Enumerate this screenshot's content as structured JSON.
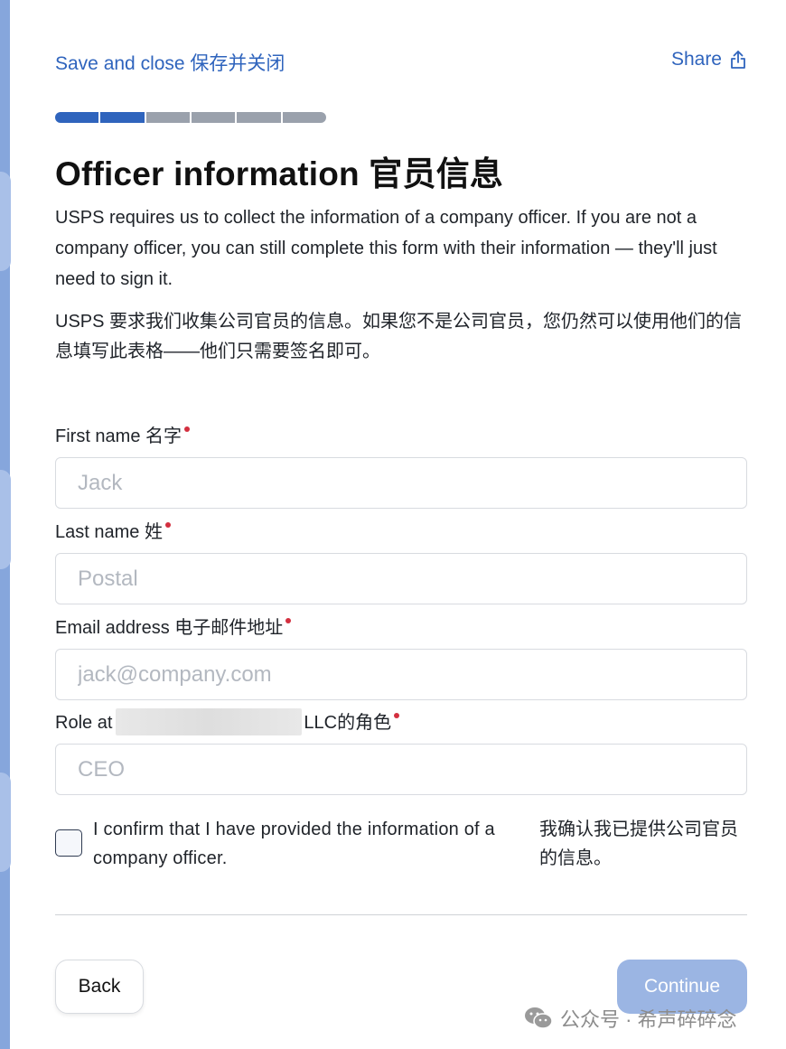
{
  "header": {
    "save_close_label": "Save and close 保存并关闭",
    "share_label": "Share"
  },
  "progress": {
    "completed_steps": 2,
    "total_steps": 6
  },
  "page": {
    "title": "Officer information 官员信息",
    "description_en": "USPS requires us to collect the information of a company officer. If you are not a company officer, you can still complete this form with their information — they'll just need to sign it.",
    "description_zh": "USPS 要求我们收集公司官员的信息。如果您不是公司官员，您仍然可以使用他们的信息填写此表格——他们只需要签名即可。"
  },
  "form": {
    "first_name": {
      "label": "First name 名字",
      "placeholder": "Jack",
      "value": ""
    },
    "last_name": {
      "label": "Last name 姓",
      "placeholder": "Postal",
      "value": ""
    },
    "email": {
      "label": "Email address 电子邮件地址",
      "placeholder": "jack@company.com",
      "value": ""
    },
    "role": {
      "label_prefix": "Role at",
      "label_suffix": "LLC的角色",
      "placeholder": "CEO",
      "value": ""
    },
    "confirm": {
      "checked": false,
      "label_en": "I confirm that I have provided the information of a company officer.",
      "label_zh": "我确认我已提供公司官员的信息。"
    }
  },
  "actions": {
    "back_label": "Back",
    "continue_label": "Continue"
  },
  "watermark": {
    "text": "公众号 · 希声碎碎念"
  },
  "icons": {
    "share": "share-upload-icon",
    "watermark": "wechat-icon"
  },
  "colors": {
    "accent": "#2f64bd",
    "required": "#d32f3f",
    "continue_disabled": "#9bb5e3",
    "progress_pending": "#9aa1ac",
    "rail": "#86a6dc"
  }
}
